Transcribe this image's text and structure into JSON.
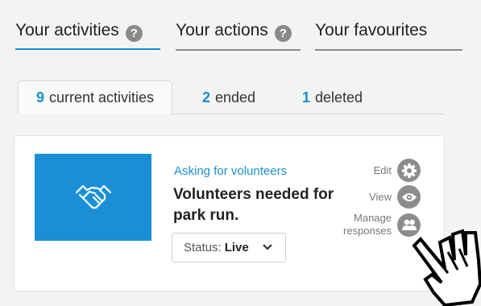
{
  "tabs": [
    {
      "label": "Your activities",
      "help": "?"
    },
    {
      "label": "Your actions",
      "help": "?"
    },
    {
      "label": "Your favourites"
    }
  ],
  "subtabs": [
    {
      "count": "9",
      "label": "current activities"
    },
    {
      "count": "2",
      "label": "ended"
    },
    {
      "count": "1",
      "label": "deleted"
    }
  ],
  "activity": {
    "category": "Asking for volunteers",
    "title": "Volunteers needed for park run.",
    "status_label": "Status:",
    "status_value": "Live",
    "actions": {
      "edit": "Edit",
      "view": "View",
      "manage_line1": "Manage",
      "manage_line2": "responses"
    }
  },
  "colors": {
    "accent": "#1a8fcf",
    "thumb": "#1a8fd6",
    "icon": "#8c8c8c"
  }
}
